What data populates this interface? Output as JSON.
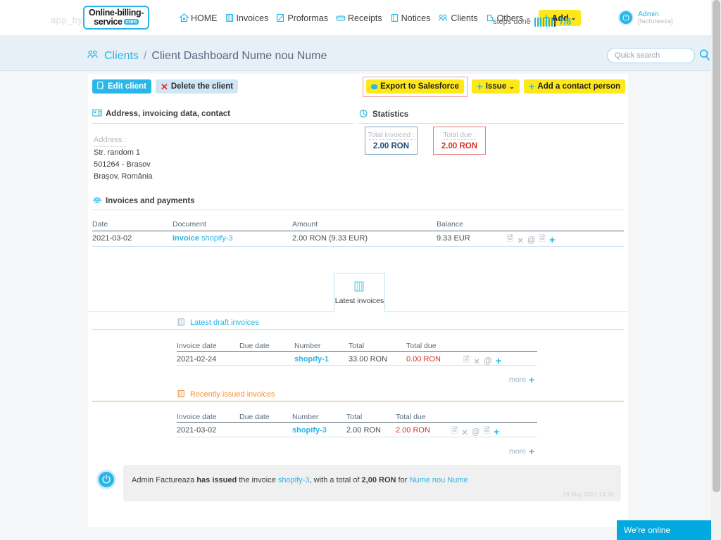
{
  "header": {
    "app_by": "app_by",
    "logo": {
      "line1": "Online-billing-",
      "line2": "service",
      "badge": "com"
    },
    "nav": [
      {
        "label": "HOME",
        "icon": "home-icon"
      },
      {
        "label": "Invoices",
        "icon": "invoices-icon"
      },
      {
        "label": "Proformas",
        "icon": "proformas-icon"
      },
      {
        "label": "Receipts",
        "icon": "receipts-icon"
      },
      {
        "label": "Notices",
        "icon": "notices-icon"
      },
      {
        "label": "Clients",
        "icon": "clients-icon"
      },
      {
        "label": "Others",
        "icon": "others-icon",
        "caret": "⌄"
      }
    ],
    "add_button": {
      "label": "Add",
      "plus": "+",
      "caret": "⌄"
    },
    "steps": {
      "label": "steps done",
      "value": "7/8",
      "done": 7,
      "total": 8
    },
    "user": {
      "name": "Admin",
      "sub": "[factureaza]",
      "icon": "power-avatar-icon"
    }
  },
  "breadcrumb": {
    "root": "Clients",
    "separator": "/",
    "current": "Client Dashboard Nume nou Nume",
    "icon": "clients-icon"
  },
  "search": {
    "placeholder": "Quick search",
    "value": "",
    "icon": "search-icon"
  },
  "actions": {
    "edit_client": "Edit client",
    "delete_client": "Delete the client",
    "export_salesforce": "Export to Salesforce",
    "issue": "Issue",
    "add_contact": "Add a contact person",
    "caret": "⌄",
    "plus": "+"
  },
  "address_section": {
    "title": "Address, invoicing data, contact",
    "icon": "contact-card-icon",
    "label": "Address :",
    "lines": [
      "Str. random 1",
      "501264 - Brasov",
      "Brașov, România"
    ]
  },
  "statistics": {
    "title": "Statistics",
    "icon": "statistics-icon",
    "total_invoiced": {
      "label": "Total invoiced :",
      "value": "2.00 RON"
    },
    "total_due": {
      "label": "Total due :",
      "value": "2.00 RON"
    }
  },
  "invoices_payments": {
    "title": "Invoices and payments",
    "icon": "scales-icon",
    "columns": [
      "Date",
      "Document",
      "Amount",
      "Balance"
    ],
    "rows": [
      {
        "date": "2021-03-02",
        "document_type": "Invoice",
        "document_number": "shopify-3",
        "amount": "2.00 RON (9.33 EUR)",
        "balance": "9.33 EUR"
      }
    ]
  },
  "tab": {
    "label": "Latest invoices",
    "icon": "invoices-icon"
  },
  "draft_invoices": {
    "title": "Latest draft invoices",
    "icon": "draft-invoices-icon",
    "columns": [
      "Invoice date",
      "Due date",
      "Number",
      "Total",
      "Total due"
    ],
    "rows": [
      {
        "invoice_date": "2021-02-24",
        "due_date": "",
        "number": "shopify-1",
        "total": "33.00 RON",
        "total_due": "0.00 RON"
      }
    ],
    "more": "more"
  },
  "issued_invoices": {
    "title": "Recently issued invoices",
    "icon": "issued-invoices-icon",
    "columns": [
      "Invoice date",
      "Due date",
      "Number",
      "Total",
      "Total due"
    ],
    "rows": [
      {
        "invoice_date": "2021-03-02",
        "due_date": "",
        "number": "shopify-3",
        "total": "2.00 RON",
        "total_due": "2.00 RON"
      }
    ],
    "more": "more"
  },
  "row_icons": {
    "edit": "edit-icon",
    "delete": "delete-icon",
    "email": "email-icon",
    "copy": "copy-icon",
    "add": "+"
  },
  "activity": {
    "actor": "Admin Factureaza",
    "verb": "has issued",
    "middle": "the invoice",
    "invoice": "shopify-3",
    "tail": ", with a total of",
    "amount": "2,00 RON",
    "for": "for",
    "client": "Nume nou Nume",
    "timestamp": "19 May 2021 14:20",
    "icon": "power-avatar-icon"
  },
  "chat": {
    "label": "We're online",
    "arrow": "▼"
  },
  "colors": {
    "accent": "#29b6e8",
    "yellow": "#ffe81a",
    "red": "#d93025",
    "orange": "#f59031",
    "band": "#e7eff7"
  }
}
